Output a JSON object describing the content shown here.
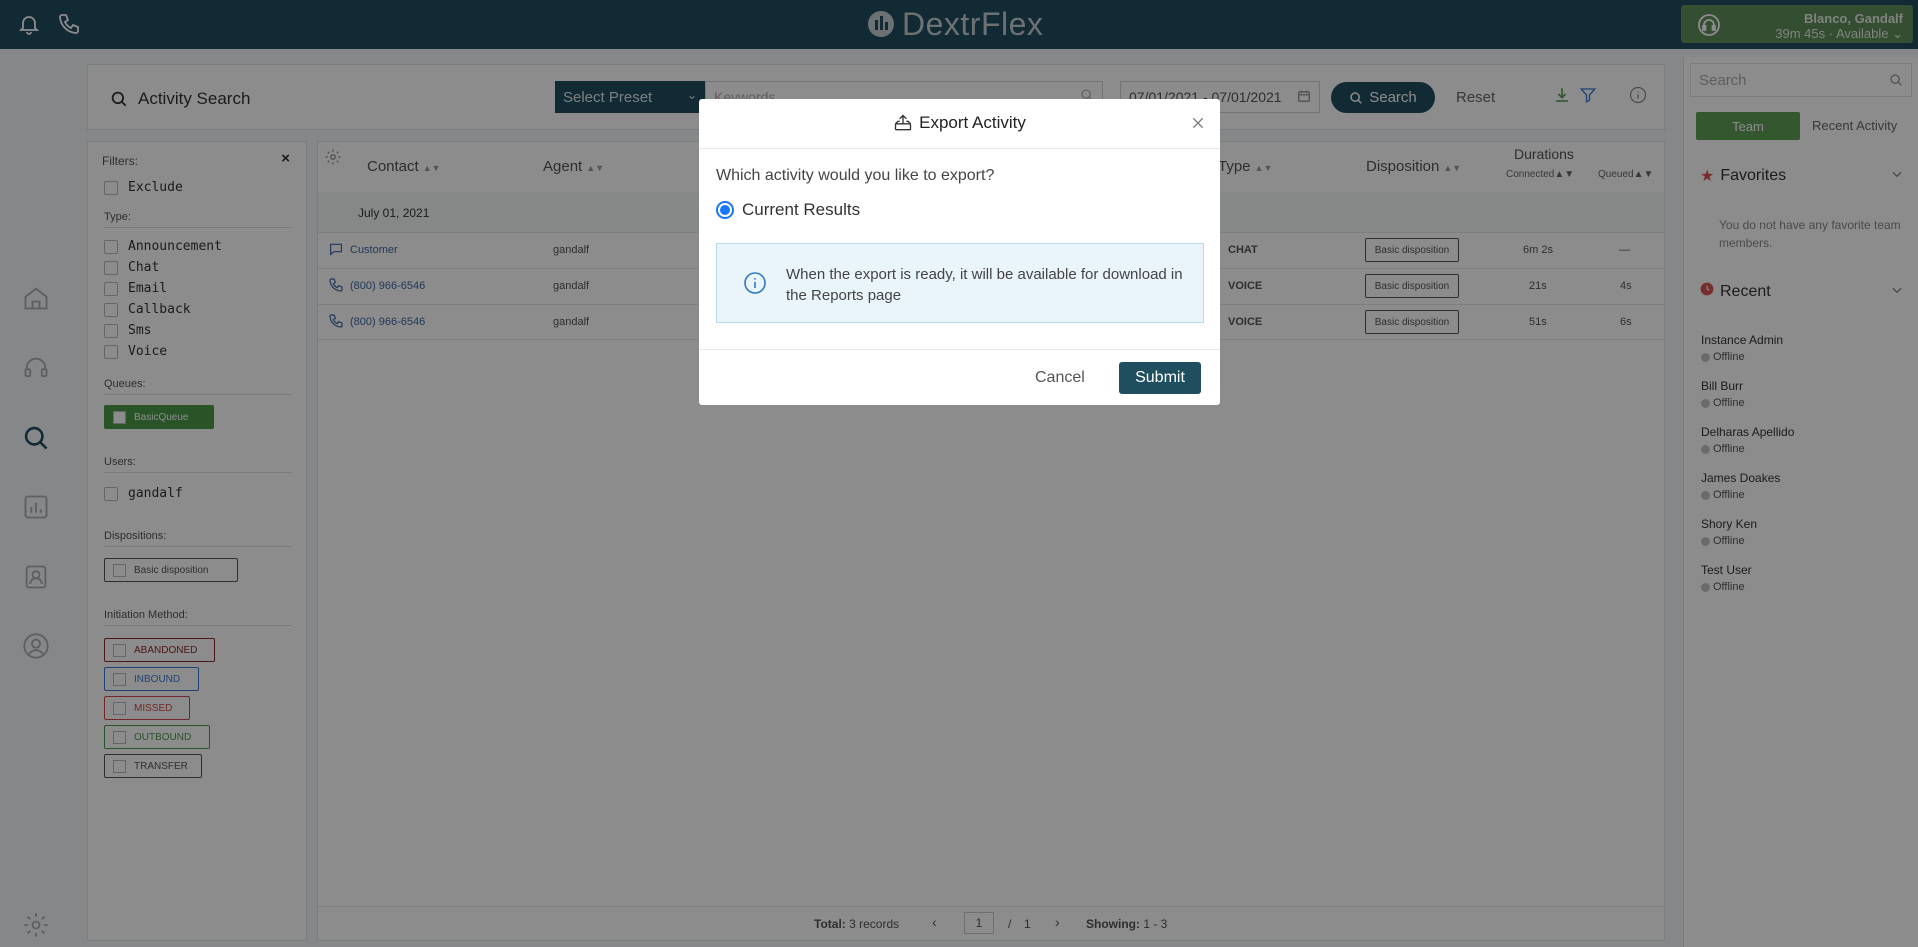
{
  "header": {
    "logo_text": "DextrFlex",
    "user_name": "Blanco, Gandalf",
    "user_status": "39m 45s · Available"
  },
  "search": {
    "title": "Activity Search",
    "preset_label": "Select Preset",
    "keywords_placeholder": "Keywords",
    "date_range": "07/01/2021 - 07/01/2021",
    "search_label": "Search",
    "reset_label": "Reset"
  },
  "filters": {
    "title": "Filters:",
    "exclude_label": "Exclude",
    "type_label": "Type:",
    "types": [
      "Announcement",
      "Chat",
      "Email",
      "Callback",
      "Sms",
      "Voice"
    ],
    "queues_label": "Queues:",
    "queue": "BasicQueue",
    "users_label": "Users:",
    "user": "gandalf",
    "dispositions_label": "Dispositions:",
    "disposition": "Basic disposition",
    "initiation_label": "Initiation Method:",
    "methods": [
      "ABANDONED",
      "INBOUND",
      "MISSED",
      "OUTBOUND",
      "TRANSFER"
    ]
  },
  "table": {
    "columns": {
      "contact": "Contact",
      "agent": "Agent",
      "type": "Type",
      "disposition": "Disposition",
      "durations": "Durations",
      "connected": "Connected",
      "queued": "Queued"
    },
    "date_group": "July 01, 2021",
    "rows": [
      {
        "contact": "Customer",
        "agent": "gandalf",
        "type": "CHAT",
        "disposition": "Basic disposition",
        "connected": "6m 2s",
        "queued": "—"
      },
      {
        "contact": "(800) 966-6546",
        "agent": "gandalf",
        "type": "VOICE",
        "disposition": "Basic disposition",
        "connected": "21s",
        "queued": "4s"
      },
      {
        "contact": "(800) 966-6546",
        "agent": "gandalf",
        "type": "VOICE",
        "disposition": "Basic disposition",
        "connected": "51s",
        "queued": "6s"
      }
    ],
    "footer": {
      "total_label": "Total:",
      "total_value": "3 records",
      "page_current": "1",
      "page_sep": "/",
      "page_total": "1",
      "showing_label": "Showing:",
      "showing_value": "1 - 3"
    }
  },
  "sidebar": {
    "search_placeholder": "Search",
    "tab_team": "Team",
    "tab_recent": "Recent Activity",
    "favorites_title": "Favorites",
    "no_favorites": "You do not have any favorite team members.",
    "recent_title": "Recent",
    "members": [
      {
        "name": "Instance Admin",
        "status": "Offline"
      },
      {
        "name": "Bill Burr",
        "status": "Offline"
      },
      {
        "name": "Delharas Apellido",
        "status": "Offline"
      },
      {
        "name": "James Doakes",
        "status": "Offline"
      },
      {
        "name": "Shory Ken",
        "status": "Offline"
      },
      {
        "name": "Test User",
        "status": "Offline"
      }
    ]
  },
  "modal": {
    "title": "Export Activity",
    "question": "Which activity would you like to export?",
    "option": "Current Results",
    "info": "When the export is ready, it will be available for download in the Reports page",
    "cancel_label": "Cancel",
    "submit_label": "Submit"
  },
  "colors": {
    "brand": "#1f4e5f",
    "accent_green": "#5f9e57",
    "info_blue": "#2f78c4"
  }
}
